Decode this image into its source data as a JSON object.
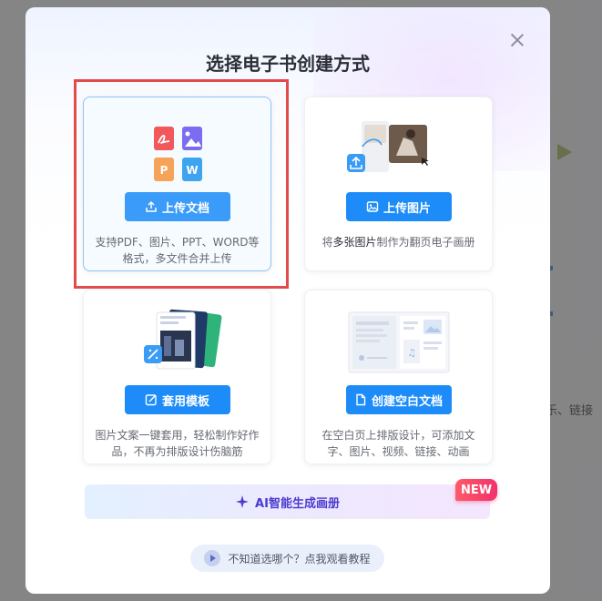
{
  "background": {
    "partial_text": "乐、链接"
  },
  "modal": {
    "title": "选择电子书创建方式",
    "close_label": "×"
  },
  "cards": {
    "upload_doc": {
      "button": "上传文档",
      "description": "支持PDF、图片、PPT、WORD等格式，多文件合并上传",
      "file_icons": [
        "P",
        "W"
      ]
    },
    "upload_image": {
      "button": "上传图片",
      "description_prefix": "将",
      "description_bold": "多张图片",
      "description_suffix": "制作为翻页电子画册"
    },
    "template": {
      "button": "套用模板",
      "description": "图片文案一键套用，轻松制作好作品，不再为排版设计伤脑筋"
    },
    "blank_doc": {
      "button": "创建空白文档",
      "description": "在空白页上排版设计，可添加文字、图片、视频、链接、动画"
    }
  },
  "ai": {
    "label": "AI智能生成画册",
    "badge": "NEW"
  },
  "tutorial": {
    "label": "不知道选哪个？点我观看教程"
  },
  "colors": {
    "primary": "#1d8cf8",
    "highlight": "#e34b4b",
    "ai_text": "#4b3ccf",
    "badge": "#f0326b"
  }
}
